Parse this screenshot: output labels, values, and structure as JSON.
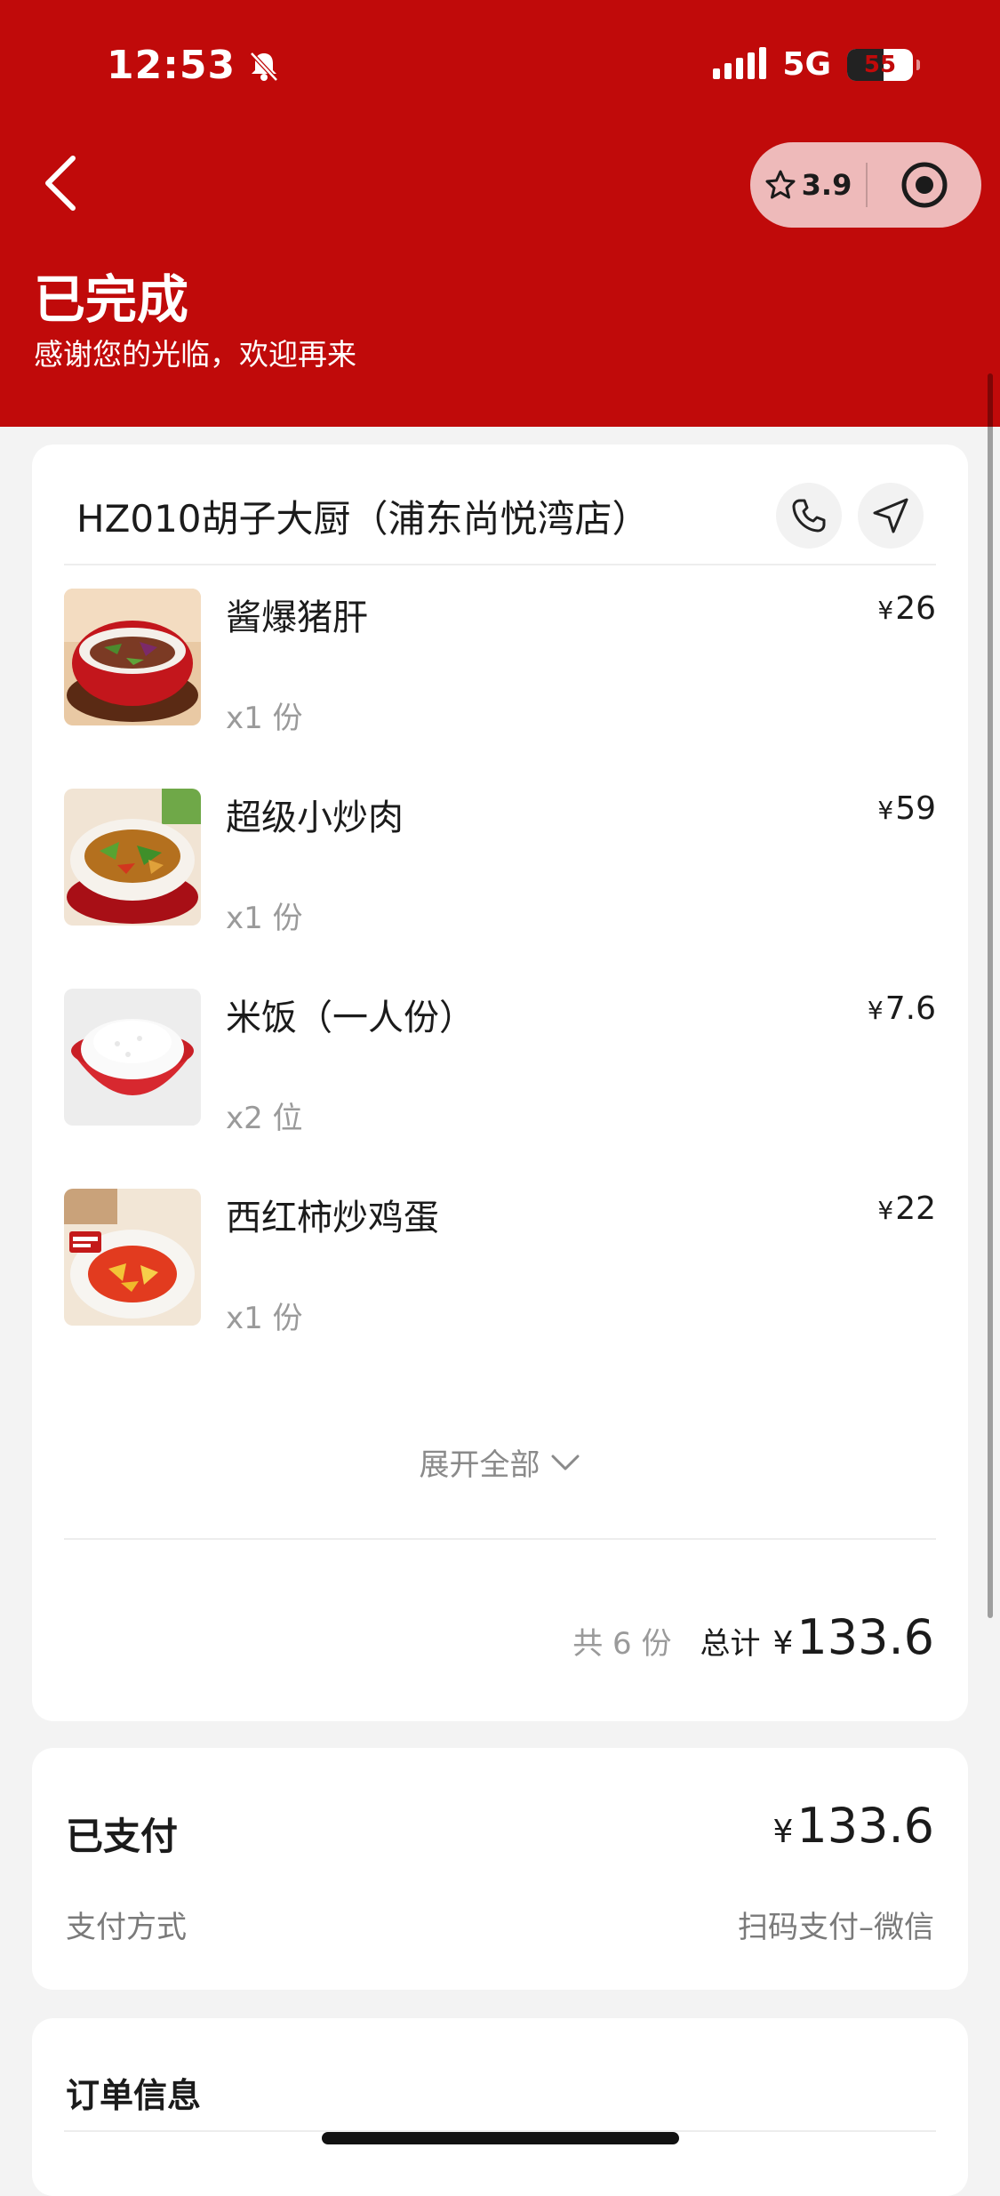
{
  "status_bar": {
    "time": "12:53",
    "network": "5G",
    "battery": "55",
    "battery_level": 0.55
  },
  "header": {
    "rating": "3.9",
    "title": "已完成",
    "subtitle": "感谢您的光临，欢迎再来"
  },
  "order": {
    "store_name": "HZ010胡子大厨（浦东尚悦湾店）",
    "currency": "¥",
    "items": [
      {
        "name": "酱爆猪肝",
        "qty": "x1 份",
        "price": "26"
      },
      {
        "name": "超级小炒肉",
        "qty": "x1 份",
        "price": "59"
      },
      {
        "name": "米饭（一人份）",
        "qty": "x2 位",
        "price": "7.6"
      },
      {
        "name": "西红柿炒鸡蛋",
        "qty": "x1 份",
        "price": "22"
      }
    ],
    "expand_label": "展开全部",
    "total_count": "共 6 份",
    "total_label": "总计",
    "total_amount": "133.6"
  },
  "payment": {
    "title": "已支付",
    "amount": "133.6",
    "method_label": "支付方式",
    "method_value": "扫码支付–微信"
  },
  "order_info": {
    "title": "订单信息"
  },
  "colors": {
    "brand_red": "#c00a0a",
    "background": "#f3f3f3"
  }
}
